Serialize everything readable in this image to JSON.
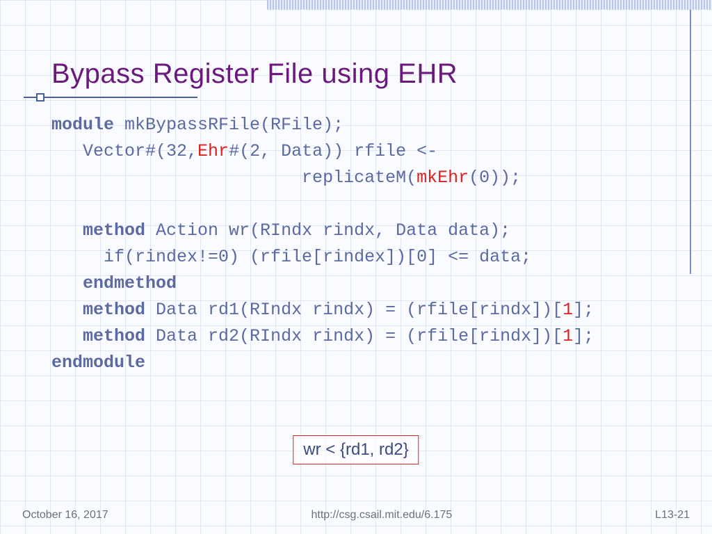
{
  "title": "Bypass Register File using EHR",
  "code": {
    "l1_kw": "module",
    "l1_rest": " mkBypassRFile(RFile);",
    "l2a": "   Vector#(32,",
    "l2_red": "Ehr",
    "l2b": "#(2, Data)) rfile <-",
    "l3a": "                        replicateM(",
    "l3_red": "mkEhr",
    "l3b": "(0));",
    "blank": "",
    "l5_kw": "   method",
    "l5_rest": " Action wr(RIndx rindx, Data data);",
    "l6": "     if(rindex!=0) (rfile[rindex])[0] <= data;",
    "l7_kw": "   endmethod",
    "l8_kw": "   method",
    "l8a": " Data rd1(RIndx rindx) = (rfile[rindx])[",
    "l8_red": "1",
    "l8b": "];",
    "l9_kw": "   method",
    "l9a": " Data rd2(RIndx rindx) = (rfile[rindx])[",
    "l9_red": "1",
    "l9b": "];",
    "l10_kw": "endmodule"
  },
  "callout": "wr < {rd1, rd2}",
  "footer": {
    "date": "October 16, 2017",
    "url": "http://csg.csail.mit.edu/6.175",
    "page": "L13-21"
  }
}
